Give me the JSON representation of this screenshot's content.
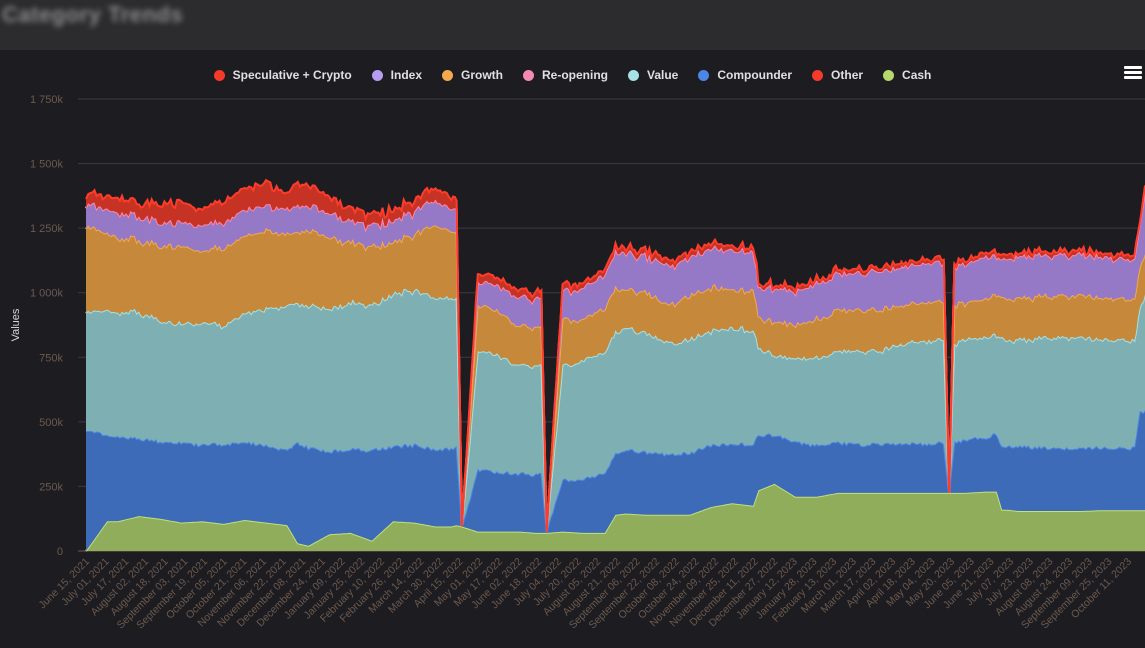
{
  "header": {
    "title": "Category Trends"
  },
  "menu": {
    "icon": "hamburger-menu-icon"
  },
  "chart_data": {
    "type": "area",
    "stacked": true,
    "title": "",
    "xlabel": "",
    "ylabel": "Values",
    "ylim": [
      0,
      1750000
    ],
    "yticks": [
      "0",
      "250k",
      "500k",
      "750k",
      "1 000k",
      "1 250k",
      "1 500k",
      "1 750k"
    ],
    "ytick_values": [
      0,
      250000,
      500000,
      750000,
      1000000,
      1250000,
      1500000,
      1750000
    ],
    "grid": true,
    "legend_position": "top-center",
    "x_range": [
      "2021-06-15",
      "2023-10-27"
    ],
    "xticks": [
      "June 15, 2021",
      "July 01, 2021",
      "July 17, 2021",
      "August 02, 2021",
      "August 18, 2021",
      "September 03, 2021",
      "September 19, 2021",
      "October 05, 2021",
      "October 21, 2021",
      "November 06, 2021",
      "November 22, 2021",
      "December 08, 2021",
      "December 24, 2021",
      "January 09, 2022",
      "January 25, 2022",
      "February 10, 2022",
      "February 26, 2022",
      "March 14, 2022",
      "March 30, 2022",
      "April 15, 2022",
      "May 01, 2022",
      "May 17, 2022",
      "June 02, 2022",
      "June 18, 2022",
      "July 04, 2022",
      "July 20, 2022",
      "August 05, 2022",
      "August 21, 2022",
      "September 06, 2022",
      "September 22, 2022",
      "October 08, 2022",
      "October 24, 2022",
      "November 09, 2022",
      "November 25, 2022",
      "December 11, 2022",
      "December 27, 2022",
      "January 12, 2023",
      "January 28, 2023",
      "February 13, 2023",
      "March 01, 2023",
      "March 17, 2023",
      "April 02, 2023",
      "April 18, 2023",
      "May 04, 2023",
      "May 20, 2023",
      "June 05, 2023",
      "June 21, 2023",
      "July 07, 2023",
      "July 23, 2023",
      "August 08, 2023",
      "August 24, 2023",
      "September 09, 2023",
      "September 25, 2023",
      "October 11, 2023"
    ],
    "x": [
      0,
      0.02,
      0.03,
      0.05,
      0.07,
      0.09,
      0.11,
      0.13,
      0.15,
      0.17,
      0.19,
      0.2,
      0.21,
      0.23,
      0.25,
      0.27,
      0.29,
      0.31,
      0.33,
      0.345,
      0.35,
      0.355,
      0.37,
      0.39,
      0.41,
      0.425,
      0.43,
      0.435,
      0.45,
      0.47,
      0.49,
      0.5,
      0.51,
      0.53,
      0.55,
      0.57,
      0.59,
      0.61,
      0.63,
      0.635,
      0.65,
      0.67,
      0.69,
      0.71,
      0.73,
      0.75,
      0.77,
      0.77,
      0.79,
      0.81,
      0.815,
      0.82,
      0.83,
      0.85,
      0.86,
      0.865,
      0.87,
      0.88,
      0.9,
      0.92,
      0.94,
      0.96,
      0.98,
      0.99,
      0.995,
      1.0
    ],
    "series": [
      {
        "name": "Cash",
        "color": "#8fad5a",
        "line": "#c3e07a",
        "values": [
          0,
          115,
          115,
          135,
          125,
          110,
          115,
          105,
          120,
          110,
          100,
          30,
          20,
          65,
          70,
          40,
          115,
          110,
          95,
          95,
          100,
          95,
          75,
          75,
          75,
          70,
          70,
          70,
          75,
          70,
          70,
          140,
          145,
          140,
          140,
          140,
          170,
          185,
          175,
          235,
          260,
          210,
          210,
          225,
          225,
          225,
          225,
          225,
          225,
          225,
          225,
          225,
          225,
          230,
          230,
          160,
          160,
          155,
          155,
          155,
          155,
          158,
          158,
          158,
          158,
          158
        ]
      },
      {
        "name": "Compounder",
        "color": "#3d6bb8",
        "line": "#4a87e6",
        "values": [
          470,
          330,
          330,
          300,
          300,
          310,
          295,
          310,
          300,
          300,
          290,
          390,
          380,
          320,
          325,
          350,
          290,
          300,
          300,
          300,
          300,
          0,
          240,
          230,
          225,
          225,
          230,
          10,
          200,
          210,
          230,
          240,
          250,
          240,
          235,
          240,
          240,
          230,
          240,
          215,
          190,
          210,
          200,
          195,
          185,
          190,
          190,
          190,
          190,
          195,
          0,
          200,
          205,
          210,
          225,
          240,
          245,
          250,
          245,
          245,
          245,
          243,
          243,
          240,
          380,
          380
        ]
      },
      {
        "name": "Value",
        "color": "#7eb0b3",
        "line": "#a5e1e6",
        "values": [
          460,
          480,
          480,
          490,
          470,
          460,
          470,
          460,
          500,
          530,
          560,
          540,
          550,
          550,
          570,
          560,
          590,
          600,
          590,
          580,
          570,
          0,
          460,
          450,
          420,
          420,
          420,
          0,
          440,
          460,
          470,
          470,
          470,
          460,
          430,
          440,
          440,
          450,
          440,
          340,
          310,
          320,
          340,
          350,
          360,
          360,
          385,
          385,
          400,
          395,
          0,
          380,
          390,
          390,
          380,
          420,
          410,
          410,
          420,
          430,
          430,
          420,
          420,
          410,
          400,
          450
        ]
      },
      {
        "name": "Growth",
        "color": "#c6883a",
        "line": "#f5a84c",
        "values": [
          330,
          300,
          290,
          280,
          290,
          300,
          280,
          300,
          300,
          300,
          280,
          270,
          290,
          280,
          230,
          230,
          200,
          220,
          280,
          260,
          250,
          0,
          180,
          170,
          150,
          150,
          150,
          0,
          180,
          160,
          170,
          170,
          150,
          155,
          150,
          170,
          170,
          150,
          160,
          120,
          130,
          130,
          150,
          160,
          160,
          155,
          150,
          150,
          150,
          150,
          0,
          150,
          140,
          150,
          160,
          160,
          160,
          160,
          160,
          160,
          160,
          160,
          160,
          160,
          160,
          160
        ]
      },
      {
        "name": "Index",
        "color": "#9579c6",
        "line": "#b89bf2",
        "values": [
          85,
          90,
          95,
          95,
          90,
          90,
          100,
          100,
          100,
          95,
          95,
          100,
          100,
          95,
          80,
          85,
          85,
          90,
          95,
          90,
          90,
          0,
          90,
          100,
          110,
          110,
          110,
          0,
          110,
          120,
          130,
          140,
          140,
          140,
          150,
          150,
          150,
          150,
          150,
          120,
          130,
          130,
          140,
          140,
          140,
          150,
          150,
          150,
          150,
          150,
          0,
          150,
          150,
          160,
          150,
          150,
          160,
          160,
          160,
          160,
          160,
          155,
          155,
          150,
          160,
          240
        ]
      },
      {
        "name": "Other",
        "color": "#c4382a",
        "line": "#ff3b2a",
        "values": [
          0,
          0,
          0,
          0,
          0,
          0,
          0,
          0,
          0,
          0,
          0,
          0,
          0,
          0,
          0,
          0,
          0,
          0,
          0,
          0,
          0,
          0,
          0,
          0,
          0,
          0,
          0,
          0,
          0,
          0,
          0,
          0,
          0,
          0,
          0,
          0,
          0,
          0,
          0,
          0,
          0,
          0,
          0,
          0,
          0,
          0,
          0,
          0,
          0,
          0,
          0,
          0,
          0,
          0,
          0,
          0,
          0,
          0,
          0,
          0,
          0,
          0,
          0,
          0,
          0,
          0
        ]
      },
      {
        "name": "Re-opening",
        "color": "#e07a9a",
        "line": "#f58ab0",
        "values": [
          0,
          0,
          0,
          0,
          0,
          0,
          0,
          0,
          0,
          0,
          0,
          0,
          0,
          0,
          0,
          0,
          0,
          0,
          0,
          0,
          0,
          0,
          0,
          0,
          0,
          0,
          0,
          0,
          0,
          0,
          0,
          0,
          0,
          0,
          0,
          0,
          0,
          0,
          0,
          0,
          0,
          0,
          0,
          0,
          0,
          0,
          0,
          0,
          0,
          0,
          0,
          0,
          0,
          0,
          0,
          0,
          0,
          0,
          0,
          0,
          0,
          0,
          0,
          0,
          0,
          0
        ]
      },
      {
        "name": "Speculative + Crypto",
        "color": "#c63324",
        "line": "#ff3b2a",
        "values": [
          40,
          50,
          60,
          50,
          70,
          80,
          60,
          80,
          80,
          90,
          60,
          90,
          80,
          60,
          50,
          40,
          40,
          40,
          50,
          40,
          40,
          0,
          30,
          30,
          25,
          25,
          25,
          0,
          20,
          20,
          20,
          20,
          20,
          20,
          20,
          20,
          20,
          15,
          15,
          15,
          15,
          15,
          15,
          15,
          15,
          15,
          15,
          15,
          15,
          15,
          0,
          15,
          15,
          15,
          15,
          15,
          15,
          15,
          15,
          15,
          15,
          15,
          15,
          15,
          15,
          20
        ]
      }
    ],
    "value_units": "thousands"
  },
  "legend": [
    {
      "label": "Speculative + Crypto",
      "color": "#f53a2b"
    },
    {
      "label": "Index",
      "color": "#b89bf2"
    },
    {
      "label": "Growth",
      "color": "#f5a84c"
    },
    {
      "label": "Re-opening",
      "color": "#f58ab0"
    },
    {
      "label": "Value",
      "color": "#a5e1e6"
    },
    {
      "label": "Compounder",
      "color": "#4a87e6"
    },
    {
      "label": "Other",
      "color": "#f53a2b"
    },
    {
      "label": "Cash",
      "color": "#b5d96b"
    }
  ]
}
